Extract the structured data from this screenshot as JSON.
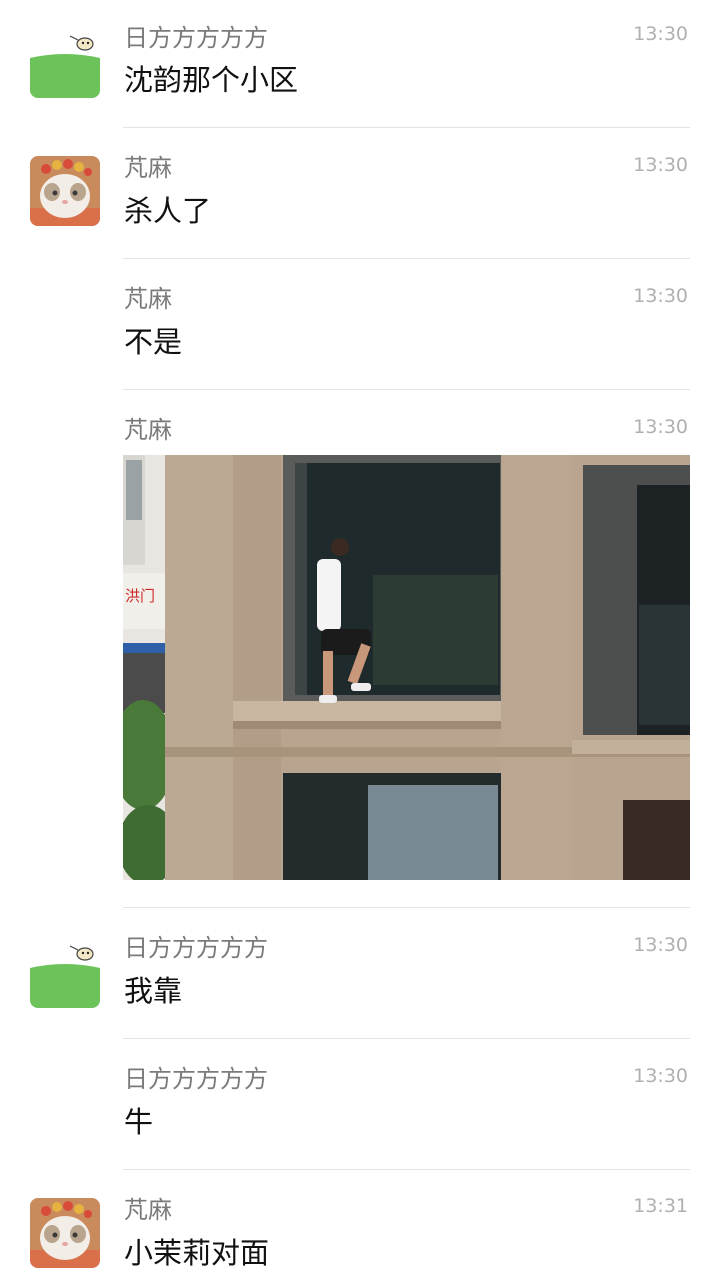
{
  "messages": [
    {
      "sender": "日方方方方方",
      "time": "13:30",
      "text": "沈韵那个小区",
      "avatar": "green-field-bee-avatar"
    },
    {
      "sender": "芃麻",
      "time": "13:30",
      "text": "杀人了",
      "avatar": "cat-with-flower-crown-avatar"
    },
    {
      "sender": "芃麻",
      "time": "13:30",
      "text": "不是"
    },
    {
      "sender": "芃麻",
      "time": "13:30",
      "image": "photo-man-sitting-on-window-ledge"
    },
    {
      "sender": "日方方方方方",
      "time": "13:30",
      "text": "我靠",
      "avatar": "green-field-bee-avatar"
    },
    {
      "sender": "日方方方方方",
      "time": "13:30",
      "text": "牛"
    },
    {
      "sender": "芃麻",
      "time": "13:31",
      "text": "小茉莉对面",
      "avatar": "cat-with-flower-crown-avatar"
    }
  ],
  "photo": {
    "sign_text": "洪门",
    "colors": {
      "wall": "#b8a48e",
      "glass": "#1f2a2c",
      "tree": "#4a7a3a"
    }
  }
}
